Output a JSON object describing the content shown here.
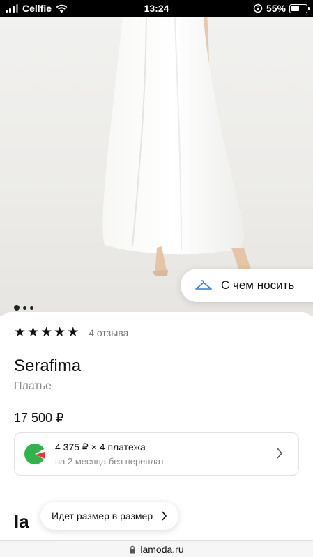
{
  "status_bar": {
    "carrier": "Cellfie",
    "time": "13:24",
    "battery_percent": "55%",
    "battery_level": 0.55
  },
  "gallery": {
    "total_images": 3,
    "active_index": 0,
    "wear_with_label": "С чем носить"
  },
  "product": {
    "rating": 5,
    "reviews_label": "4 отзыва",
    "brand": "Serafima",
    "category": "Платье",
    "price": "17 500 ₽"
  },
  "installment": {
    "main": "4 375 ₽ × 4 платежа",
    "sub": "на 2 месяца без переплат"
  },
  "footer": {
    "logo": "la",
    "size_chip_label": "Идет размер в размер"
  },
  "browser": {
    "url": "lamoda.ru"
  },
  "colors": {
    "installment_green": "#2fb34a",
    "wear_with_icon": "#2a7de1"
  }
}
